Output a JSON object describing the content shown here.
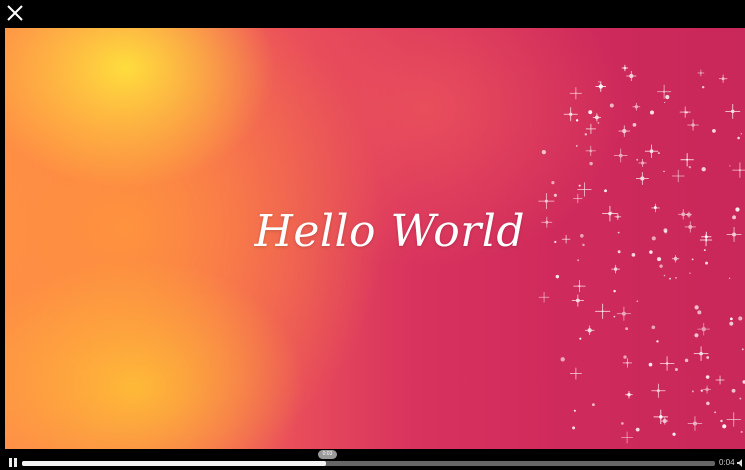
{
  "video": {
    "title_text": "Hello World"
  },
  "controls": {
    "close_icon": "close-icon",
    "pause_icon": "pause-icon",
    "volume_icon": "volume-icon",
    "progress_fraction": 0.438,
    "seek_tooltip": "0:03",
    "time_display": "0:04"
  },
  "colors": {
    "bar_background": "#000000",
    "progress_fill": "#f4f4f4",
    "progress_track": "#666666"
  }
}
